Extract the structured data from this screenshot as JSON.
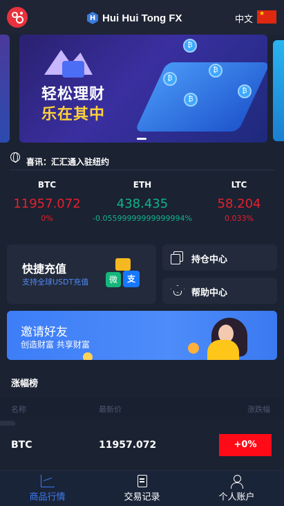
{
  "header": {
    "brand_icon_letter": "H",
    "brand_name": "Hui Hui Tong FX",
    "language": "中文",
    "flag": "china-flag-icon"
  },
  "banner": {
    "line1": "轻松理财",
    "line2": "乐在其中"
  },
  "news": {
    "text": "喜讯：汇汇通入驻纽约"
  },
  "tickers": [
    {
      "symbol": "BTC",
      "price": "11957.072",
      "change": "0%",
      "color": "#e8202c"
    },
    {
      "symbol": "ETH",
      "price": "438.435",
      "change": "-0.05599999999999994%",
      "color": "#11b38a"
    },
    {
      "symbol": "LTC",
      "price": "58.204",
      "change": "0.033%",
      "color": "#e8202c"
    }
  ],
  "quick_recharge": {
    "title": "快捷充值",
    "subtitle": "支持全球USDT充值",
    "pay_icon_wechat": "微",
    "pay_icon_alipay": "支"
  },
  "side_cards": {
    "positions": "持仓中心",
    "help": "帮助中心"
  },
  "invite": {
    "title": "邀请好友",
    "subtitle": "创造财富 共享财富"
  },
  "ranking": {
    "title": "涨幅榜",
    "columns": [
      "名称",
      "最新价",
      "涨跌幅"
    ],
    "rows": [
      {
        "symbol": "BTC",
        "price": "11957.072",
        "change": "+0%"
      }
    ]
  },
  "tabbar": {
    "items": [
      {
        "label": "商品行情",
        "icon": "chart-icon",
        "active": true
      },
      {
        "label": "交易记录",
        "icon": "document-icon",
        "active": false
      },
      {
        "label": "个人账户",
        "icon": "user-icon",
        "active": false
      }
    ]
  },
  "colors": {
    "accent": "#3d7df7",
    "up": "#e8202c",
    "down": "#11b38a",
    "background": "#1b2232"
  }
}
